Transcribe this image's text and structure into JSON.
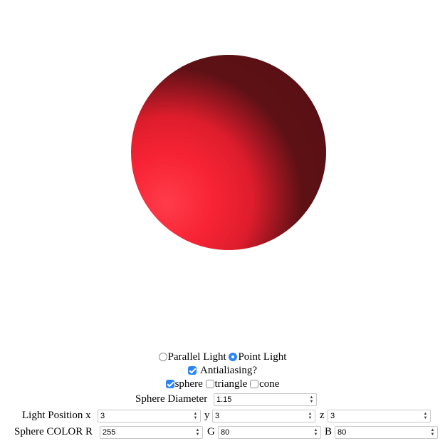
{
  "scene": {
    "background": "#ffffff",
    "sphere_color": {
      "r": 255,
      "g": 80,
      "b": 80
    }
  },
  "controls": {
    "lighting": {
      "parallel_label": "Parallel Light",
      "point_label": "Point Light",
      "selected": "Point Light"
    },
    "antialiasing": {
      "label": "Antialiasing?",
      "checked": true
    },
    "shapes": [
      {
        "label": "sphere",
        "checked": true
      },
      {
        "label": "triangle",
        "checked": false
      },
      {
        "label": "cone",
        "checked": false
      }
    ],
    "sphere_diameter": {
      "label": "Sphere Diameter",
      "value": "1.15"
    },
    "light_position": {
      "label": "Light Position x",
      "x": "3",
      "y_label": "y",
      "y": "3",
      "z_label": "z",
      "z": "3"
    },
    "sphere_color": {
      "label": "Sphere COLOR R",
      "r": "255",
      "g_label": "G",
      "g": "80",
      "b_label": "B",
      "b": "80"
    }
  },
  "icons": {
    "spinner": "stepper-arrows-icon",
    "radio": "radio-icon",
    "checkbox": "checkbox-icon"
  }
}
